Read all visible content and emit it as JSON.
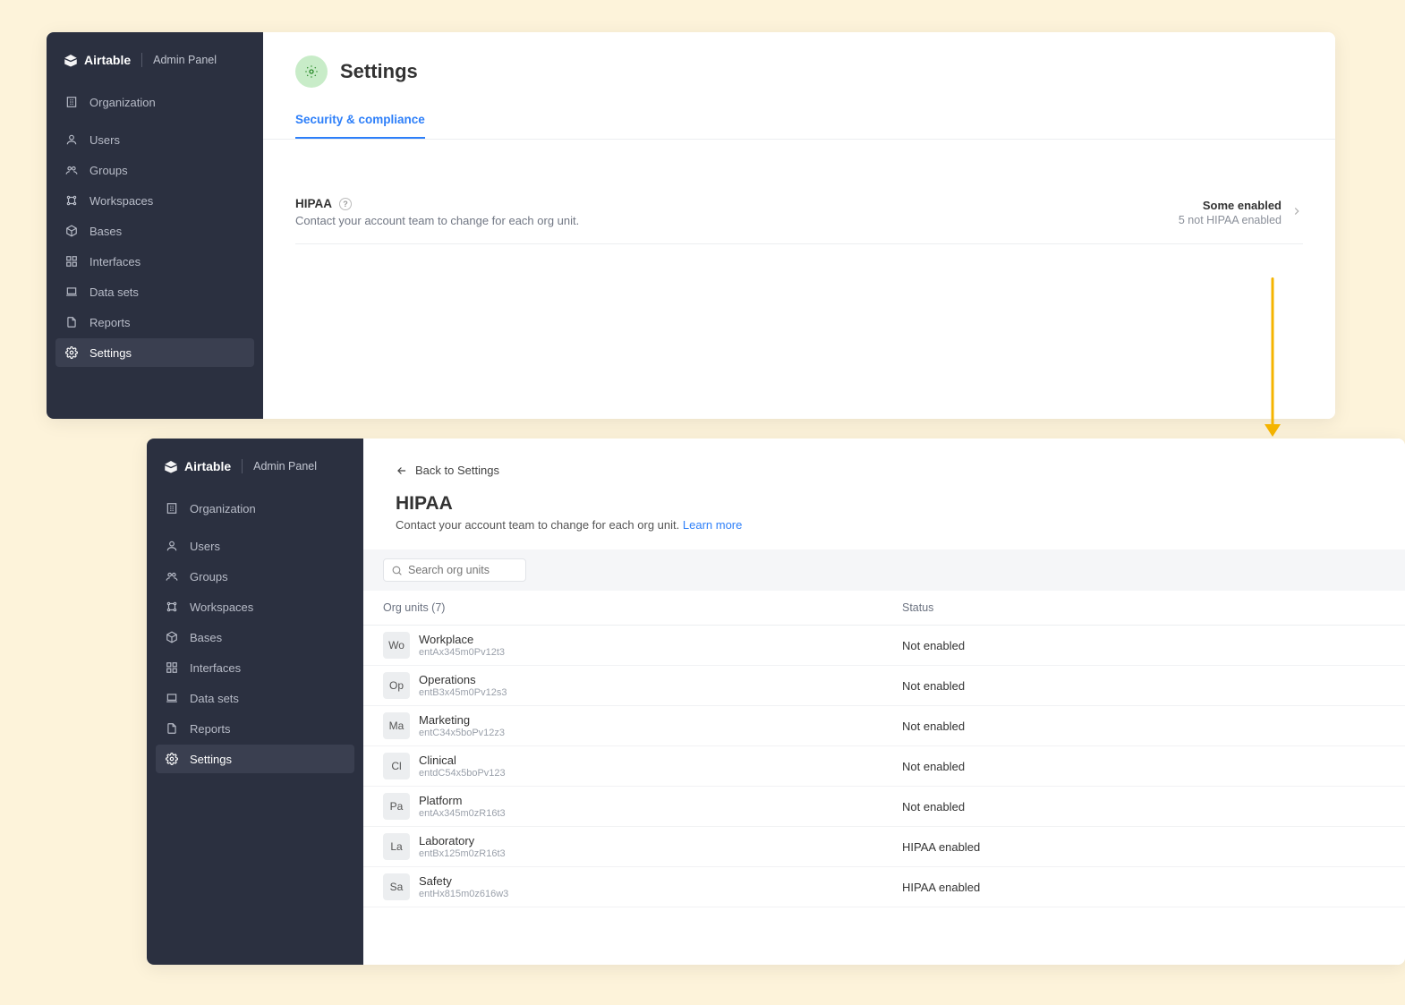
{
  "brand": {
    "name": "Airtable",
    "sub": "Admin Panel"
  },
  "sidebar": {
    "items": [
      {
        "label": "Organization"
      },
      {
        "label": "Users"
      },
      {
        "label": "Groups"
      },
      {
        "label": "Workspaces"
      },
      {
        "label": "Bases"
      },
      {
        "label": "Interfaces"
      },
      {
        "label": "Data sets"
      },
      {
        "label": "Reports"
      },
      {
        "label": "Settings"
      }
    ]
  },
  "panel1": {
    "title": "Settings",
    "tab": "Security & compliance",
    "hipaa": {
      "title": "HIPAA",
      "sub": "Contact your account team to change for each org unit.",
      "status_title": "Some enabled",
      "status_sub": "5 not HIPAA enabled"
    }
  },
  "panel2": {
    "back": "Back to Settings",
    "title": "HIPAA",
    "sub": "Contact your account team to change for each org unit.",
    "learn": "Learn more",
    "search_placeholder": "Search org units",
    "col_org": "Org units (7)",
    "col_status": "Status",
    "rows": [
      {
        "badge": "Wo",
        "name": "Workplace",
        "id": "entAx345m0Pv12t3",
        "status": "Not enabled"
      },
      {
        "badge": "Op",
        "name": "Operations",
        "id": "entB3x45m0Pv12s3",
        "status": "Not enabled"
      },
      {
        "badge": "Ma",
        "name": "Marketing",
        "id": "entC34x5boPv12z3",
        "status": "Not enabled"
      },
      {
        "badge": "Cl",
        "name": "Clinical",
        "id": "entdC54x5boPv123",
        "status": "Not enabled"
      },
      {
        "badge": "Pa",
        "name": "Platform",
        "id": "entAx345m0zR16t3",
        "status": "Not enabled"
      },
      {
        "badge": "La",
        "name": "Laboratory",
        "id": "entBx125m0zR16t3",
        "status": "HIPAA enabled"
      },
      {
        "badge": "Sa",
        "name": "Safety",
        "id": "entHx815m0z616w3",
        "status": "HIPAA enabled"
      }
    ]
  }
}
